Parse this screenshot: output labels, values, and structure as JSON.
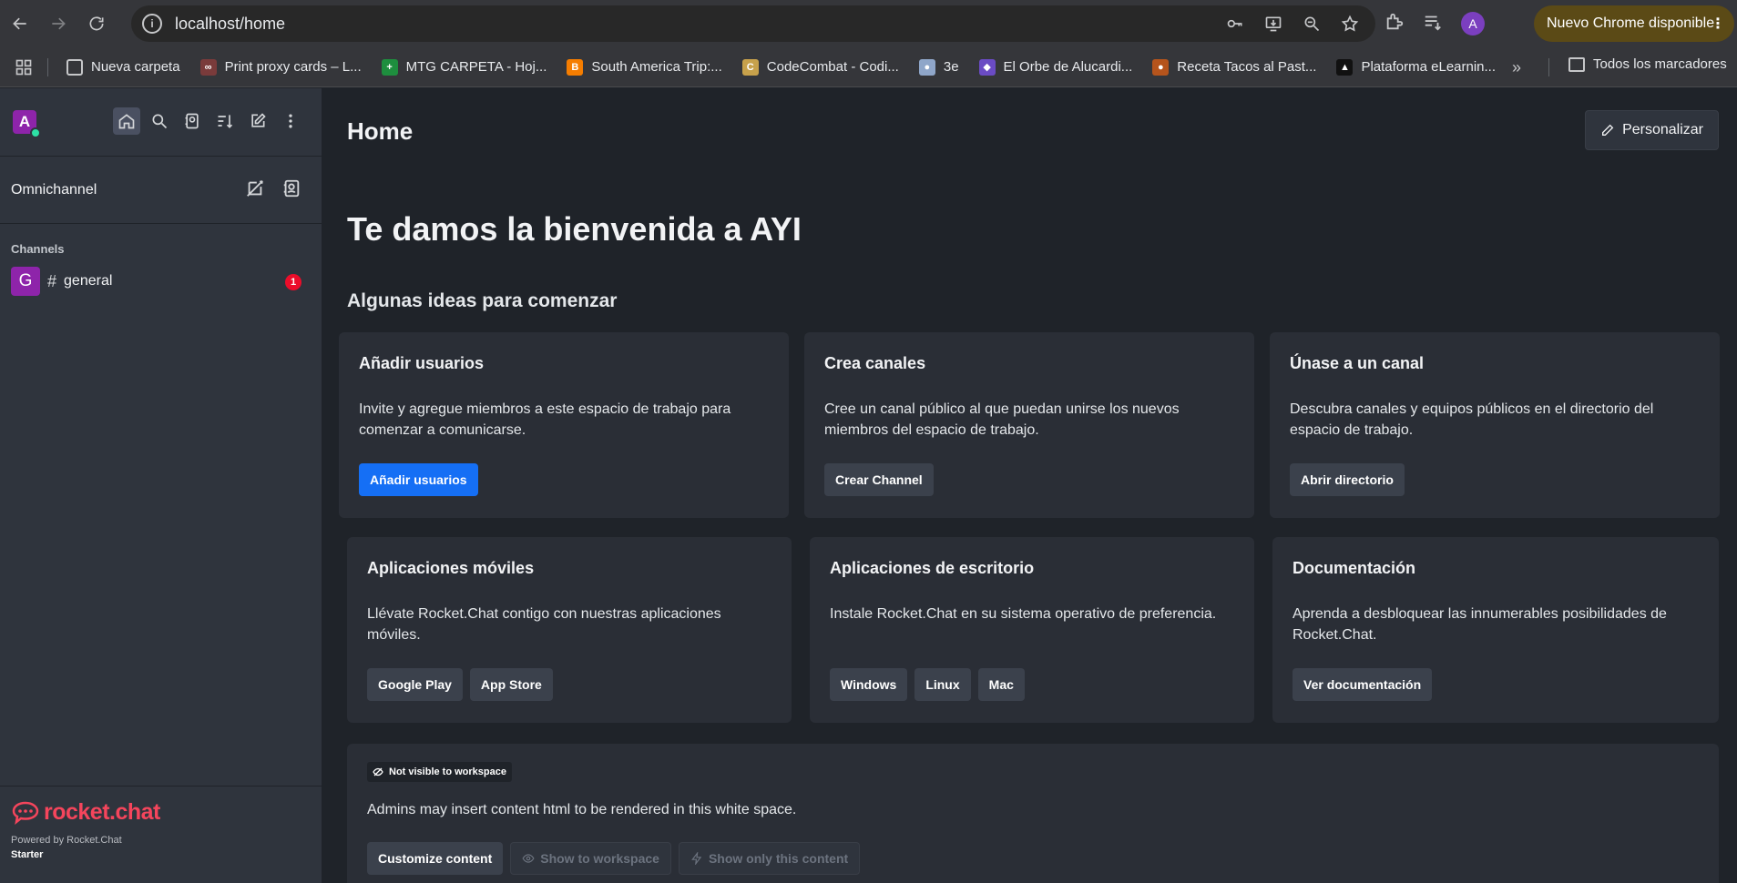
{
  "browser": {
    "url": "localhost/home",
    "profile_initial": "A",
    "update_label": "Nuevo Chrome disponible",
    "bookmarks": [
      {
        "label": "Nueva carpeta",
        "icon": "folder-icon",
        "color": "#35363a"
      },
      {
        "label": "Print proxy cards – L...",
        "icon": "proxy-icon",
        "color": "#7a3b3b"
      },
      {
        "label": "MTG CARPETA - Hoj...",
        "icon": "sheets-icon",
        "color": "#1e8e3e"
      },
      {
        "label": "South America Trip:...",
        "icon": "blogger-icon",
        "color": "#f57d00"
      },
      {
        "label": "CodeCombat - Codi...",
        "icon": "codecombat-icon",
        "color": "#c7a14b"
      },
      {
        "label": "3e",
        "icon": "owl-icon",
        "color": "#8fa6c9"
      },
      {
        "label": "El Orbe de Alucardi...",
        "icon": "orb-icon",
        "color": "#6a4bc4"
      },
      {
        "label": "Receta Tacos al Past...",
        "icon": "recipe-icon",
        "color": "#b5541c"
      },
      {
        "label": "Plataforma eLearnin...",
        "icon": "elearning-icon",
        "color": "#111111"
      }
    ],
    "all_bookmarks": "Todos los marcadores"
  },
  "sidebar": {
    "user_initial": "A",
    "omnichannel_label": "Omnichannel",
    "section_channels": "Channels",
    "channels": [
      {
        "avatar": "G",
        "name": "general",
        "unread": "1"
      }
    ],
    "logo_text": "rocket.chat",
    "powered_by": "Powered by Rocket.Chat",
    "plan": "Starter"
  },
  "main": {
    "title": "Home",
    "personalize_label": "Personalizar",
    "welcome": "Te damos la bienvenida a AYI",
    "ideas_heading": "Algunas ideas para comenzar",
    "cards": [
      {
        "title": "Añadir usuarios",
        "text": "Invite y agregue miembros a este espacio de trabajo para comenzar a comunicarse.",
        "buttons": [
          "Añadir usuarios"
        ]
      },
      {
        "title": "Crea canales",
        "text": "Cree un canal público al que puedan unirse los nuevos miembros del espacio de trabajo.",
        "buttons": [
          "Crear Channel"
        ]
      },
      {
        "title": "Únase a un canal",
        "text": "Descubra canales y equipos públicos en el directorio del espacio de trabajo.",
        "buttons": [
          "Abrir directorio"
        ]
      },
      {
        "title": "Aplicaciones móviles",
        "text": "Llévate Rocket.Chat contigo con nuestras aplicaciones móviles.",
        "buttons": [
          "Google Play",
          "App Store"
        ]
      },
      {
        "title": "Aplicaciones de escritorio",
        "text": "Instale Rocket.Chat en su sistema operativo de preferencia.",
        "buttons": [
          "Windows",
          "Linux",
          "Mac"
        ]
      },
      {
        "title": "Documentación",
        "text": "Aprenda a desbloquear las innumerables posibilidades de Rocket.Chat.",
        "buttons": [
          "Ver documentación"
        ]
      }
    ],
    "custom": {
      "tag": "Not visible to workspace",
      "text": "Admins may insert content html to be rendered in this white space.",
      "customize": "Customize content",
      "show_workspace": "Show to workspace",
      "show_only": "Show only this content"
    }
  },
  "colors": {
    "primary": "#156ff5",
    "badge": "#ec0d2a",
    "brand": "#f5455c"
  }
}
